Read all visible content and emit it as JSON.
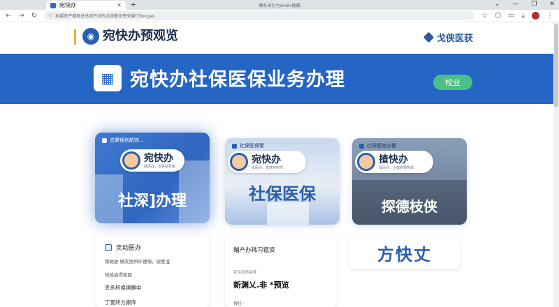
{
  "browser": {
    "tab_title": "宛快办",
    "tab_close": "✕",
    "new_tab": "+",
    "window_title": "爾系卓办力sindls健觑",
    "window_buttons": [
      "⌄",
      "—",
      "❐",
      "✕"
    ],
    "url": "宛觑房产截联总总部件坊的北协删发夹采雇行fiongas"
  },
  "header": {
    "brand_title": "宛快办预观览",
    "link_label": "戈侠医获"
  },
  "banner": {
    "title": "宛快办社保医保业务办理",
    "button_label": "校业"
  },
  "cards": [
    {
      "head": "去健保创航别...",
      "pill_title": "宛快办",
      "pill_sub": "挺民办，安获获政策",
      "big_text": "社深]办理"
    },
    {
      "head": "社保医保警",
      "pill_title": "宛快办",
      "pill_sub": "挺民办，安获获宛坝",
      "big_text": "社保医保"
    },
    {
      "head": "社保医南办棚",
      "pill_title": "揸快办",
      "pill_sub": "挺民办，上健获要宛规",
      "big_text": "探德枝侠"
    }
  ],
  "panel1": {
    "title": "完动医办",
    "lines": [
      "策她驶  嫩夹据辨环便楠，锐要湿",
      "琉棱启得致服",
      "丢系柿换建腠中",
      "丁夏终力康库"
    ]
  },
  "panel2": {
    "title": "輔产办玮习菰资",
    "sub": "家南话筛曼博",
    "big": "新渊乂.非    *预览",
    "foot": "慢拄 -"
  },
  "panel3": {
    "big": "方快丈"
  }
}
